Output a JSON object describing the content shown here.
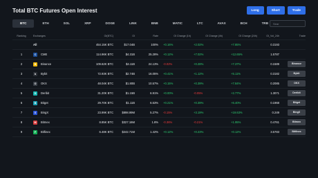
{
  "title": "Total BTC Futures Open Interest",
  "actions": [
    "Long",
    "Short",
    "Trade"
  ],
  "tabs": [
    "BTC",
    "ETH",
    "SOL",
    "XRP",
    "DOGE",
    "LINK",
    "BNB",
    "MATIC",
    "LTC",
    "AVAX",
    "BCH",
    "TRB",
    "DOT"
  ],
  "active_tab": "BTC",
  "search_placeholder": "Sear",
  "columns": [
    "Ranking",
    "Exchanges",
    "OI(BTC)",
    "OI",
    "Rate",
    "OI Change (1h)",
    "OI Change (4h)",
    "OI Change (24h)",
    "OI_Vol_24h",
    "Trade"
  ],
  "colors": {
    "background": "#12161c",
    "accent": "#2f6fe8",
    "positive": "#2ecc71",
    "negative": "#ef3b3b"
  },
  "rows": [
    {
      "rank": "",
      "exchange": "All",
      "logo": "",
      "logo_color": "",
      "oi_btc": "454.15K BTC",
      "oi": "$17.04B",
      "rate": "100%",
      "c1": "+0.16%",
      "c1_dir": "pos",
      "c4": "+2.02%",
      "c4_dir": "pos",
      "c24": "+7.85%",
      "c24_dir": "pos",
      "oivol": "0.3193",
      "trade": ""
    },
    {
      "rank": "1",
      "exchange": "CME",
      "logo": "C",
      "logo_color": "#1b4f9c",
      "oi_btc": "114.96K BTC",
      "oi": "$4.31B",
      "rate": "25.28%",
      "c1": "+0.12%",
      "c1_dir": "pos",
      "c4": "+7.02%",
      "c4_dir": "pos",
      "c24": "+12.65%",
      "c24_dir": "pos",
      "oivol": "1.5787",
      "trade": ""
    },
    {
      "rank": "2",
      "exchange": "Binance",
      "logo": "B",
      "logo_color": "#f0b90b",
      "oi_btc": "109.62K BTC",
      "oi": "$4.11B",
      "rate": "24.13%",
      "c1": "-0.02%",
      "c1_dir": "neg",
      "c4": "+0.28%",
      "c4_dir": "pos",
      "c24": "+7.37%",
      "c24_dir": "pos",
      "oivol": "0.1589",
      "trade": "Binance"
    },
    {
      "rank": "3",
      "exchange": "Bybit",
      "logo": "b",
      "logo_color": "#2b2f36",
      "oi_btc": "72.93K BTC",
      "oi": "$2.74B",
      "rate": "16.05%",
      "c1": "+0.41%",
      "c1_dir": "pos",
      "c4": "+1.12%",
      "c4_dir": "pos",
      "c24": "+5.11%",
      "c24_dir": "pos",
      "oivol": "0.3182",
      "trade": "Bybit"
    },
    {
      "rank": "4",
      "exchange": "OKX",
      "logo": "O",
      "logo_color": "#3a3f47",
      "oi_btc": "48.04K BTC",
      "oi": "$1.80B",
      "rate": "10.57%",
      "c1": "+0.15%",
      "c1_dir": "pos",
      "c4": "+0.39%",
      "c4_dir": "pos",
      "c24": "+7.84%",
      "c24_dir": "pos",
      "oivol": "0.2085",
      "trade": "OKX"
    },
    {
      "rank": "5",
      "exchange": "Deribit",
      "logo": "D",
      "logo_color": "#16b5b0",
      "oi_btc": "31.20K BTC",
      "oi": "$1.15B",
      "rate": "6.91%",
      "c1": "+0.00%",
      "c1_dir": "pos",
      "c4": "-0.05%",
      "c4_dir": "neg",
      "c24": "+2.77%",
      "c24_dir": "pos",
      "oivol": "1.3071",
      "trade": "Deribit"
    },
    {
      "rank": "6",
      "exchange": "Bitget",
      "logo": "B",
      "logo_color": "#1da2b4",
      "oi_btc": "29.70K BTC",
      "oi": "$1.11B",
      "rate": "6.53%",
      "c1": "+0.21%",
      "c1_dir": "pos",
      "c4": "+0.39%",
      "c4_dir": "pos",
      "c24": "+6.40%",
      "c24_dir": "pos",
      "oivol": "0.1968",
      "trade": "Bitget"
    },
    {
      "rank": "7",
      "exchange": "BingX",
      "logo": "X",
      "logo_color": "#2a54d6",
      "oi_btc": "23.99K BTC",
      "oi": "$898.99M",
      "rate": "5.27%",
      "c1": "-0.15%",
      "c1_dir": "neg",
      "c4": "+3.19%",
      "c4_dir": "pos",
      "c24": "+19.63%",
      "c24_dir": "pos",
      "oivol": "0.249",
      "trade": "BingX"
    },
    {
      "rank": "8",
      "exchange": "Bitmex",
      "logo": "M",
      "logo_color": "#d63a3a",
      "oi_btc": "8.85K BTC",
      "oi": "$327.16M",
      "rate": "1.8%",
      "c1": "-0.36%",
      "c1_dir": "neg",
      "c4": "-0.21%",
      "c4_dir": "neg",
      "c24": "+1.95%",
      "c24_dir": "pos",
      "oivol": "0.4761",
      "trade": "Bitmex"
    },
    {
      "rank": "9",
      "exchange": "Bitfinex",
      "logo": "F",
      "logo_color": "#16b157",
      "oi_btc": "6.48K BTC",
      "oi": "$242.71M",
      "rate": "1.42%",
      "c1": "+0.12%",
      "c1_dir": "pos",
      "c4": "+0.23%",
      "c4_dir": "pos",
      "c24": "+0.12%",
      "c24_dir": "pos",
      "oivol": "3.5783",
      "trade": "Bitfinex"
    }
  ]
}
